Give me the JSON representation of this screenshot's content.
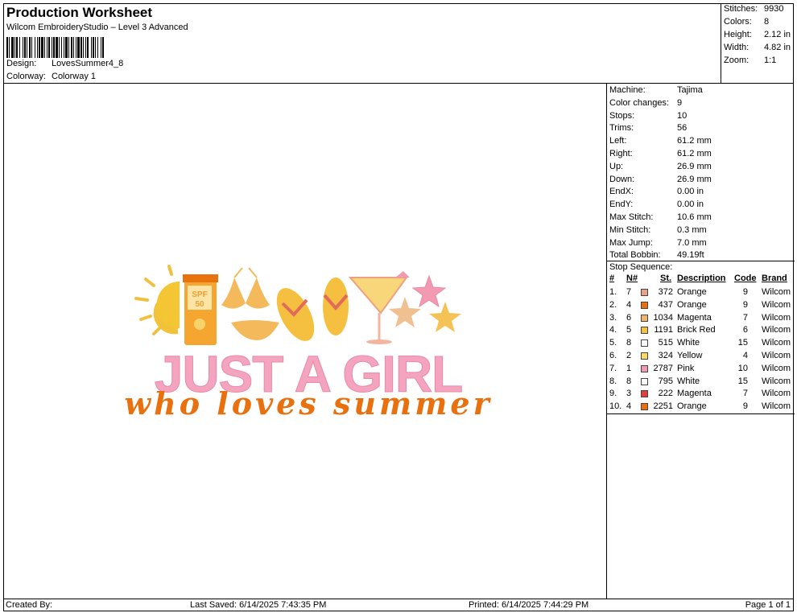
{
  "header": {
    "title": "Production Worksheet",
    "software": "Wilcom EmbroideryStudio – Level 3 Advanced",
    "design_label": "Design:",
    "design_value": "LovesSummer4_8",
    "colorway_label": "Colorway:",
    "colorway_value": "Colorway 1"
  },
  "summary": [
    {
      "label": "Stitches:",
      "value": "9930"
    },
    {
      "label": "Colors:",
      "value": "8"
    },
    {
      "label": "Height:",
      "value": "2.12 in"
    },
    {
      "label": "Width:",
      "value": "4.82 in"
    },
    {
      "label": "Zoom:",
      "value": "1:1"
    }
  ],
  "machine_info": [
    {
      "label": "Machine:",
      "value": "Tajima"
    },
    {
      "label": "Color changes:",
      "value": "9"
    },
    {
      "label": "Stops:",
      "value": "10"
    },
    {
      "label": "Trims:",
      "value": "56"
    },
    {
      "label": "Left:",
      "value": "61.2 mm"
    },
    {
      "label": "Right:",
      "value": "61.2 mm"
    },
    {
      "label": "Up:",
      "value": "26.9 mm"
    },
    {
      "label": "Down:",
      "value": "26.9 mm"
    },
    {
      "label": "EndX:",
      "value": "0.00 in"
    },
    {
      "label": "EndY:",
      "value": "0.00 in"
    },
    {
      "label": "Max Stitch:",
      "value": "10.6 mm"
    },
    {
      "label": "Min Stitch:",
      "value": "0.3 mm"
    },
    {
      "label": "Max Jump:",
      "value": "7.0 mm"
    },
    {
      "label": "Total Bobbin:",
      "value": "49.19ft"
    }
  ],
  "stop_sequence": {
    "title": "Stop Sequence:",
    "headers": {
      "num": "#",
      "n": "N#",
      "st": "St.",
      "description": "Description",
      "code": "Code",
      "brand": "Brand"
    },
    "rows": [
      {
        "num": "1.",
        "n": "7",
        "color": "#e8a48a",
        "st": "372",
        "description": "Orange",
        "code": "9",
        "brand": "Wilcom"
      },
      {
        "num": "2.",
        "n": "4",
        "color": "#e8700e",
        "st": "437",
        "description": "Orange",
        "code": "9",
        "brand": "Wilcom"
      },
      {
        "num": "3.",
        "n": "6",
        "color": "#f0b46a",
        "st": "1034",
        "description": "Magenta",
        "code": "7",
        "brand": "Wilcom"
      },
      {
        "num": "4.",
        "n": "5",
        "color": "#f4c040",
        "st": "1191",
        "description": "Brick Red",
        "code": "6",
        "brand": "Wilcom"
      },
      {
        "num": "5.",
        "n": "8",
        "color": "#ffffff",
        "st": "515",
        "description": "White",
        "code": "15",
        "brand": "Wilcom"
      },
      {
        "num": "6.",
        "n": "2",
        "color": "#fad86a",
        "st": "324",
        "description": "Yellow",
        "code": "4",
        "brand": "Wilcom"
      },
      {
        "num": "7.",
        "n": "1",
        "color": "#f29ab2",
        "st": "2787",
        "description": "Pink",
        "code": "10",
        "brand": "Wilcom"
      },
      {
        "num": "8.",
        "n": "8",
        "color": "#ffffff",
        "st": "795",
        "description": "White",
        "code": "15",
        "brand": "Wilcom"
      },
      {
        "num": "9.",
        "n": "3",
        "color": "#e0403a",
        "st": "222",
        "description": "Magenta",
        "code": "7",
        "brand": "Wilcom"
      },
      {
        "num": "10.",
        "n": "4",
        "color": "#e8700e",
        "st": "2251",
        "description": "Orange",
        "code": "9",
        "brand": "Wilcom"
      }
    ]
  },
  "design": {
    "headline": "JUST A GIRL",
    "script": "who loves summer",
    "bottle_label": "SPF\n50"
  },
  "footer": {
    "created_by": "Created By:",
    "last_saved": "Last Saved: 6/14/2025 7:43:35 PM",
    "printed": "Printed: 6/14/2025 7:44:29 PM",
    "page": "Page 1 of 1"
  }
}
